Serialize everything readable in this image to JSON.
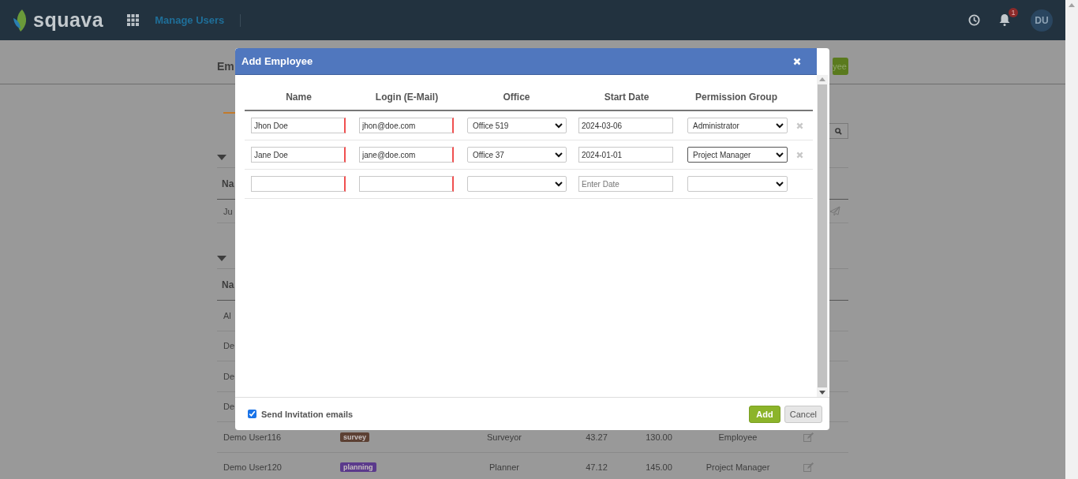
{
  "header": {
    "logo_text": "squava",
    "nav_link": "Manage Users",
    "notification_count": "1",
    "avatar": "DU"
  },
  "page": {
    "title": "Em",
    "action_button": "yee",
    "tabs": [
      {
        "selected": true
      }
    ],
    "sections": [
      {
        "kind": "invites",
        "column_header": "Na",
        "rows": [
          {
            "name": "Ju"
          }
        ]
      },
      {
        "kind": "members",
        "column_header": "Na",
        "rows": [
          {
            "name": "Al"
          },
          {
            "name": "De"
          },
          {
            "name": "De"
          },
          {
            "name": "De"
          },
          {
            "name": "Demo User116",
            "tag": {
              "label": "survey",
              "color": "#5c4033"
            },
            "role": "Surveyor",
            "column_4": "43.27",
            "column_5": "130.00",
            "group": "Employee"
          },
          {
            "name": "Demo User120",
            "tag": {
              "label": "planning",
              "color": "#5b3a8c"
            },
            "role": "Planner",
            "column_4": "47.12",
            "column_5": "145.00",
            "group": "Project Manager"
          }
        ]
      }
    ]
  },
  "dialog": {
    "title": "Add Employee",
    "columns": [
      "Name",
      "Login (E-Mail)",
      "Office",
      "Start Date",
      "Permission Group"
    ],
    "rows": [
      {
        "name": "Jhon Doe",
        "login": "jhon@doe.com",
        "office": "Office 519",
        "start_date": "2024-03-06",
        "permission_group": "Administrator",
        "removable": true,
        "focused": false
      },
      {
        "name": "Jane Doe",
        "login": "jane@doe.com",
        "office": "Office 37",
        "start_date": "2024-01-01",
        "permission_group": "Project Manager",
        "removable": true,
        "focused": true
      },
      {
        "start_date_placeholder": "Enter Date",
        "removable": false,
        "focused": false
      }
    ],
    "send_invitations": {
      "label": "Send Invitation emails",
      "checked": true
    },
    "buttons": {
      "add": "Add",
      "cancel": "Cancel"
    }
  }
}
